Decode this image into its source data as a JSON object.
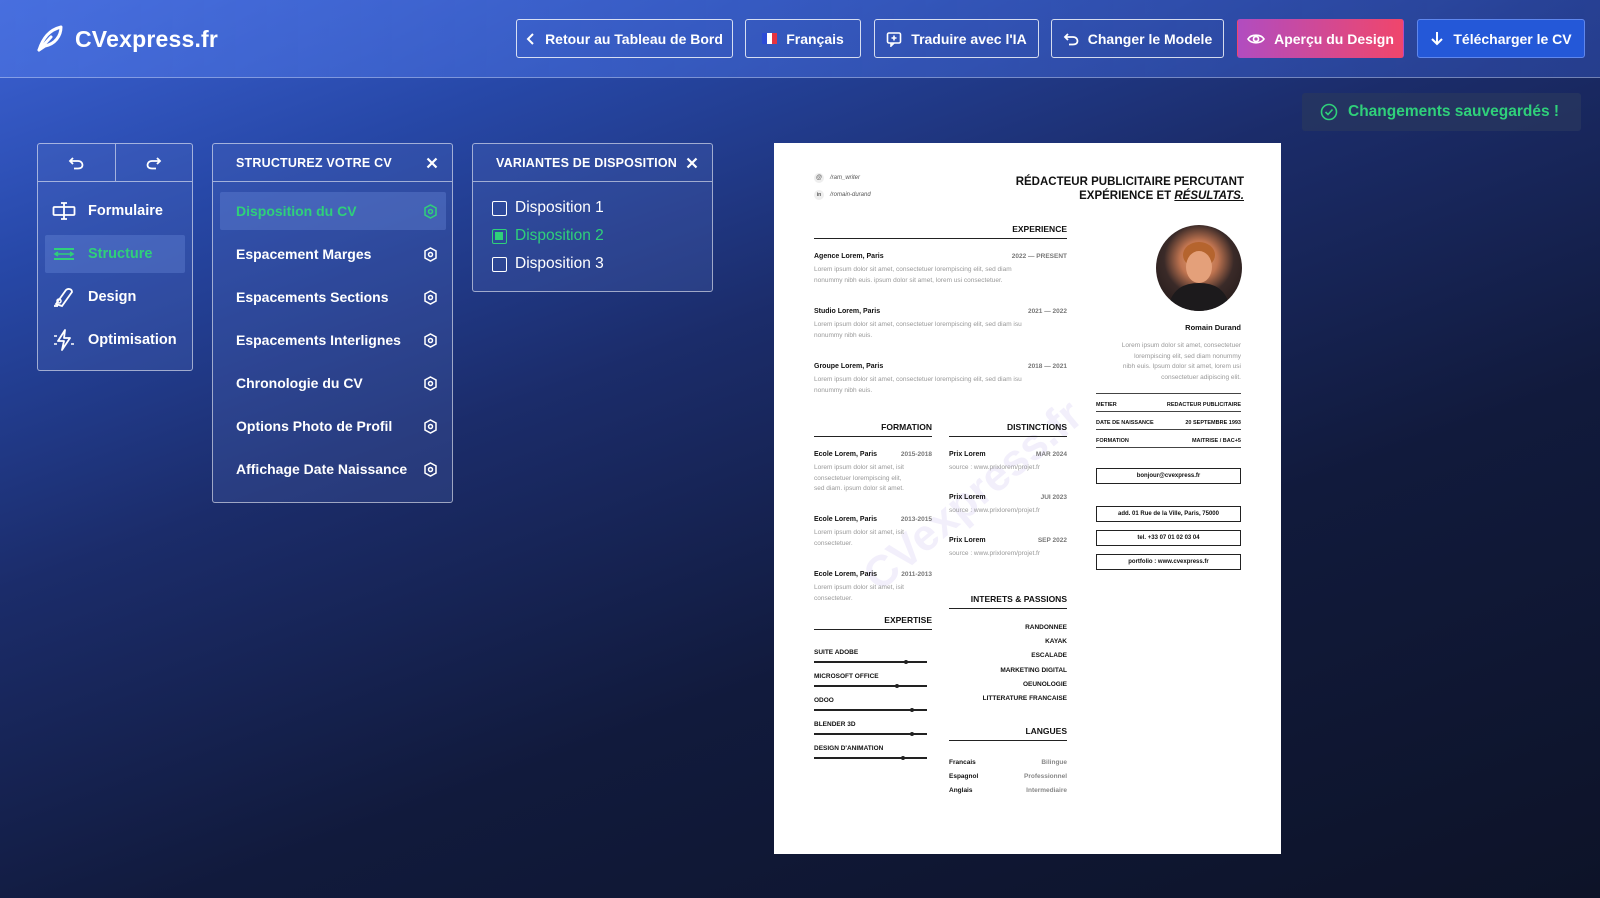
{
  "header": {
    "logo_text": "CVexpress.fr",
    "buttons": {
      "back": "Retour au Tableau de Bord",
      "language": "Français",
      "translate": "Traduire avec l'IA",
      "change_model": "Changer le Modele",
      "preview": "Aperçu du Design",
      "download": "Télécharger le CV"
    }
  },
  "status": {
    "saved": "Changements sauvegardés !"
  },
  "tools": {
    "items": [
      {
        "label": "Formulaire",
        "icon": "form-icon"
      },
      {
        "label": "Structure",
        "icon": "structure-icon"
      },
      {
        "label": "Design",
        "icon": "design-icon"
      },
      {
        "label": "Optimisation",
        "icon": "optimisation-icon"
      }
    ]
  },
  "structure": {
    "title": "STRUCTUREZ VOTRE CV",
    "items": [
      "Disposition du CV",
      "Espacement Marges",
      "Espacements Sections",
      "Espacements Interlignes",
      "Chronologie du CV",
      "Options Photo de Profil",
      "Affichage Date Naissance"
    ]
  },
  "variants": {
    "title": "VARIANTES DE DISPOSITION",
    "items": [
      "Disposition 1",
      "Disposition 2",
      "Disposition 3"
    ],
    "selected": "Disposition 2"
  },
  "cv": {
    "social": [
      "/ram_writer",
      "/romain-durand"
    ],
    "headline1": "RÉDACTEUR PUBLICITAIRE PERCUTANT",
    "headline2": "EXPÉRIENCE ET",
    "headline2b": "RÉSULTATS.",
    "experience_title": "EXPERIENCE",
    "jobs": [
      {
        "name": "Agence Lorem, Paris",
        "date": "2022 — PRESENT",
        "desc1": "Lorem ipsum dolor sit amet, consectetuer lorempiscing elit, sed diam",
        "desc2": "nonummy nibh euis. ipsum dolor sit amet, lorem usi consectetuer."
      },
      {
        "name": "Studio Lorem, Paris",
        "date": "2021 — 2022",
        "desc1": "Lorem ipsum dolor sit amet, consectetuer lorempiscing elit, sed diam isu",
        "desc2": "nonummy nibh euis."
      },
      {
        "name": "Groupe Lorem, Paris",
        "date": "2018 — 2021",
        "desc1": "Lorem ipsum dolor sit amet, consectetuer lorempiscing elit, sed diam isu",
        "desc2": "nonummy nibh euis."
      }
    ],
    "formation_title": "FORMATION",
    "formation": [
      {
        "name": "Ecole Lorem, Paris",
        "date": "2015-2018",
        "desc": [
          "Lorem ipsum dolor sit amet, isit",
          "consectetuer lorempiscing elit,",
          "sed diam. ipsum dolor sit amet."
        ]
      },
      {
        "name": "Ecole Lorem, Paris",
        "date": "2013-2015",
        "desc": [
          "Lorem ipsum dolor sit amet, isit",
          "consectetuer."
        ]
      },
      {
        "name": "Ecole Lorem, Paris",
        "date": "2011-2013",
        "desc": [
          "Lorem ipsum dolor sit amet, isit",
          "consectetuer."
        ]
      }
    ],
    "distinctions_title": "DISTINCTIONS",
    "distinctions": [
      {
        "name": "Prix Lorem",
        "date": "MAR 2024",
        "src": "source : www.prixlorem/projet.fr"
      },
      {
        "name": "Prix Lorem",
        "date": "JUI 2023",
        "src": "source : www.prixlorem/projet.fr"
      },
      {
        "name": "Prix Lorem",
        "date": "SEP 2022",
        "src": "source : www.prixlorem/projet.fr"
      }
    ],
    "expertise_title": "EXPERTISE",
    "skills": [
      {
        "name": "SUITE ADOBE",
        "level": 0.8
      },
      {
        "name": "MICROSOFT OFFICE",
        "level": 0.72
      },
      {
        "name": "ODOO",
        "level": 0.85
      },
      {
        "name": "BLENDER 3D",
        "level": 0.85
      },
      {
        "name": "DESIGN D'ANIMATION",
        "level": 0.77
      }
    ],
    "interests_title": "INTERETS & PASSIONS",
    "interests": [
      "RANDONNEE",
      "KAYAK",
      "ESCALADE",
      "MARKETING DIGITAL",
      "OEUNOLOGIE",
      "LITTERATURE FRANCAISE"
    ],
    "languages_title": "LANGUES",
    "languages": [
      {
        "name": "Francais",
        "level": "Bilingue"
      },
      {
        "name": "Espagnol",
        "level": "Professionnel"
      },
      {
        "name": "Anglais",
        "level": "Intermediaire"
      }
    ],
    "person_name": "Romain Durand",
    "bio": [
      "Lorem ipsum dolor sit amet, consectetuer",
      "lorempiscing elit, sed diam nonummy",
      "nibh euis. Ipsum dolor sit amet, lorem usi",
      "consectetuer adipiscing elit."
    ],
    "info": [
      {
        "k": "METIER",
        "v": "REDACTEUR PUBLICITAIRE"
      },
      {
        "k": "DATE DE NAISSANCE",
        "v": "20 SEPTEMBRE 1993"
      },
      {
        "k": "FORMATION",
        "v": "MAITRISE / BAC+5"
      }
    ],
    "email": "bonjour@cvexpress.fr",
    "address": "add.  01 Rue de la Ville, Paris, 75000",
    "phone": "tel. +33 07 01 02 03 04",
    "portfolio": "portfolio : www.cvexpress.fr",
    "watermark": "CVexpress.fr"
  }
}
